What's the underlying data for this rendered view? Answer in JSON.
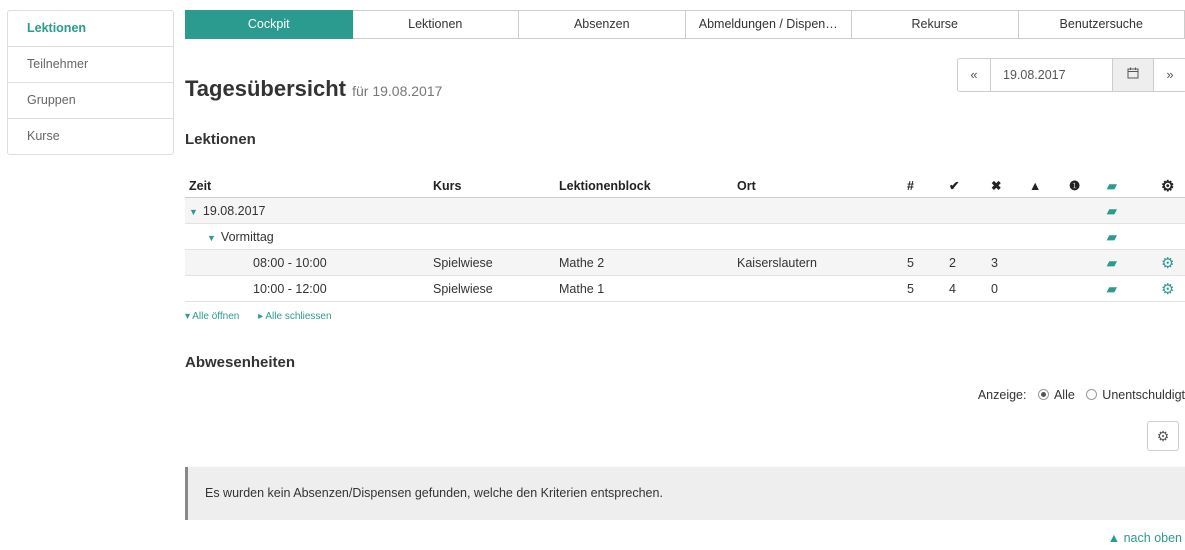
{
  "sidebar": {
    "items": [
      {
        "label": "Lektionen"
      },
      {
        "label": "Teilnehmer"
      },
      {
        "label": "Gruppen"
      },
      {
        "label": "Kurse"
      }
    ]
  },
  "tabs": [
    {
      "label": "Cockpit"
    },
    {
      "label": "Lektionen"
    },
    {
      "label": "Absenzen"
    },
    {
      "label": "Abmeldungen / Dispen…"
    },
    {
      "label": "Rekurse"
    },
    {
      "label": "Benutzersuche"
    }
  ],
  "datepicker": {
    "prev": "«",
    "value": "19.08.2017",
    "next": "»"
  },
  "heading": {
    "title": "Tagesübersicht",
    "subtitle": "für 19.08.2017"
  },
  "lektionen": {
    "title": "Lektionen",
    "columns": {
      "zeit": "Zeit",
      "kurs": "Kurs",
      "block": "Lektionenblock",
      "ort": "Ort",
      "count": "#",
      "present": "✔",
      "absent": "✖",
      "warn": "▲",
      "info": "❶"
    },
    "date_group": "19.08.2017",
    "period_group": "Vormittag",
    "rows": [
      {
        "zeit": "08:00 - 10:00",
        "kurs": "Spielwiese",
        "block": "Mathe 2",
        "ort": "Kaiserslautern",
        "count": "5",
        "present": "2",
        "absent": "3"
      },
      {
        "zeit": "10:00 - 12:00",
        "kurs": "Spielwiese",
        "block": "Mathe 1",
        "ort": "",
        "count": "5",
        "present": "4",
        "absent": "0"
      }
    ],
    "open_all": "Alle öffnen",
    "close_all": "Alle schliessen"
  },
  "abwesenheiten": {
    "title": "Abwesenheiten",
    "filter_label": "Anzeige:",
    "option_all": "Alle",
    "option_unexcused": "Unentschuldigt",
    "empty_message": "Es wurden kein Absenzen/Dispensen gefunden, welche den Kriterien entsprechen."
  },
  "back_to_top": "nach oben",
  "colors": {
    "accent": "#2b9a8f"
  }
}
